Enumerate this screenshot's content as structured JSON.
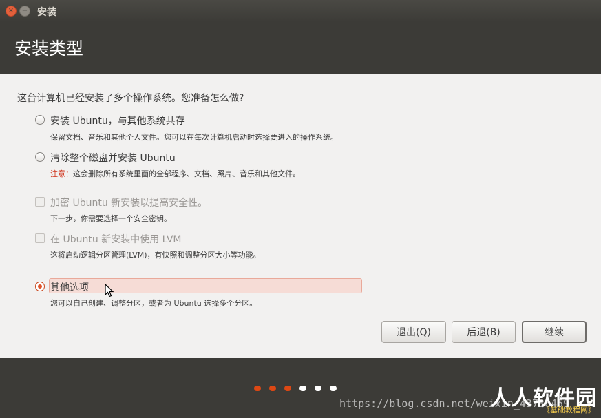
{
  "window": {
    "title": "安装",
    "close_glyph": "×",
    "min_glyph": "−"
  },
  "header": {
    "title": "安装类型"
  },
  "question": "这台计算机已经安装了多个操作系统。您准备怎么做?",
  "options": [
    {
      "label": "安装 Ubuntu，与其他系统共存",
      "desc": "保留文档、音乐和其他个人文件。您可以在每次计算机启动时选择要进入的操作系统。",
      "selected": false
    },
    {
      "label": "清除整个磁盘并安装 Ubuntu",
      "desc_prefix": "注意：",
      "desc": "这会删除所有系统里面的全部程序、文档、照片、音乐和其他文件。",
      "selected": false
    },
    {
      "label": "其他选项",
      "desc": "您可以自己创建、调整分区，或者为 Ubuntu 选择多个分区。",
      "selected": true
    }
  ],
  "checks": [
    {
      "label": "加密 Ubuntu 新安装以提高安全性。",
      "desc": "下一步，你需要选择一个安全密钥。",
      "checked": false,
      "enabled": false
    },
    {
      "label": "在 Ubuntu 新安装中使用 LVM",
      "desc": "这将启动逻辑分区管理(LVM)，有快照和调整分区大小等功能。",
      "checked": false,
      "enabled": false
    }
  ],
  "buttons": {
    "quit": "退出(Q)",
    "back": "后退(B)",
    "continue": "继续"
  },
  "progress": {
    "total_steps": 6,
    "completed_steps": 3,
    "active_color": "#dd4814",
    "inactive_color": "#ffffff"
  },
  "watermark": {
    "url": "https://blog.csdn.net/weixin_43736459",
    "logo": "人人软件园",
    "sub": "《基础教程网》"
  }
}
